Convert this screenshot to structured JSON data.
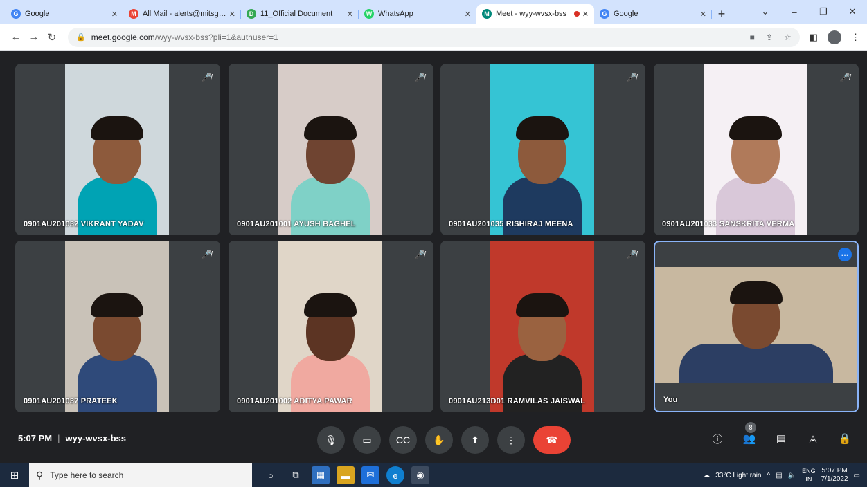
{
  "browser": {
    "tabs": [
      {
        "title": "Google",
        "fav": "G",
        "color": "#4285f4"
      },
      {
        "title": "All Mail - alerts@mitsgwl.ac.in",
        "fav": "M",
        "color": "#ea4335"
      },
      {
        "title": "11_Official Document",
        "fav": "D",
        "color": "#34a853"
      },
      {
        "title": "WhatsApp",
        "fav": "W",
        "color": "#25d366"
      },
      {
        "title": "Meet - wyy-wvsx-bss",
        "fav": "M",
        "color": "#00897b"
      },
      {
        "title": "Google",
        "fav": "G",
        "color": "#4285f4"
      }
    ],
    "url_main": "meet.google.com",
    "url_rest": "/wyy-wvsx-bss?pli=1&authuser=1"
  },
  "tiles": [
    {
      "name": "0901AU201032 VIKRANT YADAV",
      "bg": "#cfd8dc",
      "shirt": "#00a3b4",
      "skin": "#8d5a3c"
    },
    {
      "name": "0901AU201001 AYUSH BAGHEL",
      "bg": "#d7ccc8",
      "shirt": "#7fd1c7",
      "skin": "#6f4431"
    },
    {
      "name": "0901AU201035 RISHIRAJ MEENA",
      "bg": "#35c4d4",
      "shirt": "#1e3a5f",
      "skin": "#8d5a3c"
    },
    {
      "name": "0901AU201033 SANSKRITA VERMA",
      "bg": "#f5f0f4",
      "shirt": "#d9c8d9",
      "skin": "#b07a5a"
    },
    {
      "name": "0901AU201037 PRATEEK",
      "bg": "#c9c2b8",
      "shirt": "#2f4a7a",
      "skin": "#7a4a30"
    },
    {
      "name": "0901AU201002 ADITYA PAWAR",
      "bg": "#e0d6c8",
      "shirt": "#f0a9a0",
      "skin": "#5c3423"
    },
    {
      "name": "0901AU213D01 RAMVILAS JAISWAL",
      "bg": "#c0392b",
      "shirt": "#222222",
      "skin": "#9a6240"
    },
    {
      "name": "You",
      "bg": "#c8b8a0",
      "shirt": "#2c3e63",
      "skin": "#7a4a30"
    }
  ],
  "meeting": {
    "time": "5:07 PM",
    "code": "wyy-wvsx-bss"
  },
  "controls": [
    "mic",
    "camera",
    "captions",
    "raise-hand",
    "present",
    "more-options"
  ],
  "right_controls": {
    "participants_count": "8"
  },
  "taskbar": {
    "search_placeholder": "Type here to search",
    "weather": "33°C  Light rain",
    "lang": "ENG",
    "region": "IN",
    "time": "5:07 PM",
    "date": "7/1/2022"
  }
}
